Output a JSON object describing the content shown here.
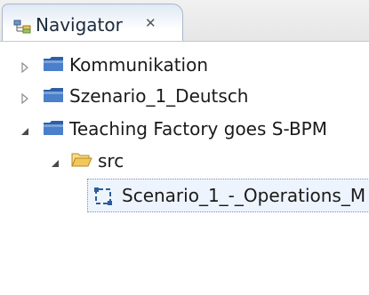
{
  "tab": {
    "title": "Navigator",
    "icon": "navigator-icon",
    "close_glyph": "✕"
  },
  "tree": {
    "items": [
      {
        "label": "Kommunikation",
        "expanded": false,
        "icon": "project-folder-icon"
      },
      {
        "label": "Szenario_1_Deutsch",
        "expanded": false,
        "icon": "project-folder-icon"
      },
      {
        "label": "Teaching Factory goes S-BPM",
        "expanded": true,
        "icon": "project-folder-icon"
      },
      {
        "label": "src",
        "expanded": true,
        "icon": "open-folder-icon"
      },
      {
        "label": "Scenario_1_-_Operations_M",
        "selected": true,
        "icon": "model-file-icon"
      }
    ]
  },
  "colors": {
    "project_folder": "#3c6fb6",
    "open_folder": "#e8b84a",
    "selection_border": "#7c95b8"
  }
}
